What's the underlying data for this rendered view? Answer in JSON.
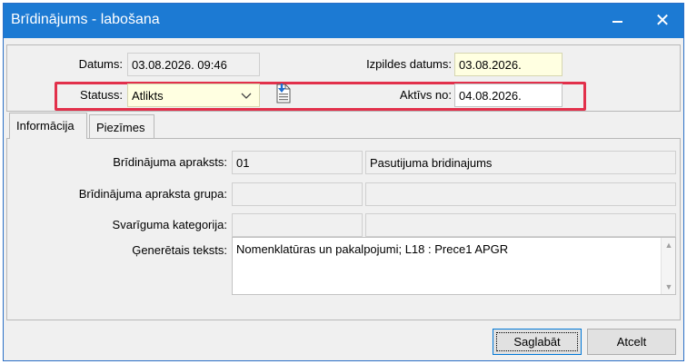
{
  "window": {
    "title": "Brīdinājums - labošana",
    "minimize_icon": "minimize-icon",
    "close_icon": "close-icon"
  },
  "header": {
    "datums_label": "Datums:",
    "datums_value": "03.08.2026. 09:46",
    "izpildes_label": "Izpildes datums:",
    "izpildes_value": "03.08.2026.",
    "statuss_label": "Statuss:",
    "statuss_value": "Atlikts",
    "aktivs_label": "Aktīvs no:",
    "aktivs_value": "04.08.2026."
  },
  "tabs": [
    {
      "label": "Informācija",
      "active": true
    },
    {
      "label": "Piezīmes",
      "active": false
    }
  ],
  "info": {
    "apraksts_label": "Brīdinājuma apraksts:",
    "apraksts_code": "01",
    "apraksts_name": "Pasutijuma bridinajums",
    "grupa_label": "Brīdinājuma apraksta grupa:",
    "grupa_code": "",
    "grupa_name": "",
    "svarigums_label": "Svarīguma kategorija:",
    "svarigums_code": "",
    "svarigums_name": "",
    "teksts_label": "Ģenerētais teksts:",
    "teksts_value": "Nomenklatūras un pakalpojumi; L18 : Prece1 APGR"
  },
  "footer": {
    "save_label": "Saglabāt",
    "cancel_label": "Atcelt"
  },
  "colors": {
    "titlebar": "#1c7ad3",
    "highlight_border": "#e2304b",
    "input_yellow": "#ffffe1"
  }
}
